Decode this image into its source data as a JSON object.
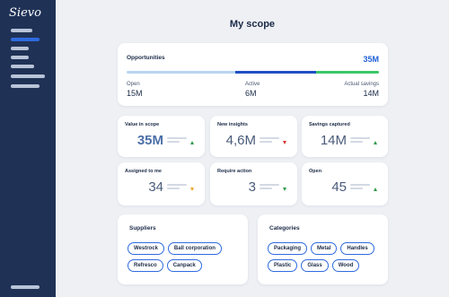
{
  "app": {
    "logo": "Sievo"
  },
  "page": {
    "title": "My scope"
  },
  "opportunities": {
    "title": "Opportunities",
    "total": "35M",
    "bar_fractions": {
      "open": 0.43,
      "active": 0.32,
      "actual_savings": 0.25
    },
    "colors": {
      "open": "#b8d4f0",
      "active": "#1f4fc4",
      "actual_savings": "#3cc76a"
    },
    "columns": [
      {
        "label": "Open",
        "value": "15M"
      },
      {
        "label": "Active",
        "value": "6M"
      },
      {
        "label": "Actual savings",
        "value": "14M"
      }
    ]
  },
  "metrics": [
    {
      "label": "Value in scope",
      "value": "35M",
      "trend": "up",
      "trend_color": "#2e9b4b"
    },
    {
      "label": "New insights",
      "value": "4,6M",
      "trend": "down",
      "trend_color": "#d9352b"
    },
    {
      "label": "Savings captured",
      "value": "14M",
      "trend": "up",
      "trend_color": "#2e9b4b"
    },
    {
      "label": "Assigned to me",
      "value": "34",
      "trend": "down",
      "trend_color": "#f0a52a"
    },
    {
      "label": "Require action",
      "value": "3",
      "trend": "down",
      "trend_color": "#2e9b4b"
    },
    {
      "label": "Open",
      "value": "45",
      "trend": "up",
      "trend_color": "#2e9b4b"
    }
  ],
  "suppliers": {
    "title": "Suppliers",
    "tags": [
      "Westrock",
      "Ball corporation",
      "Refresco",
      "Canpack"
    ]
  },
  "categories": {
    "title": "Categories",
    "tags": [
      "Packaging",
      "Metal",
      "Handles",
      "Plastic",
      "Glass",
      "Wood"
    ]
  }
}
